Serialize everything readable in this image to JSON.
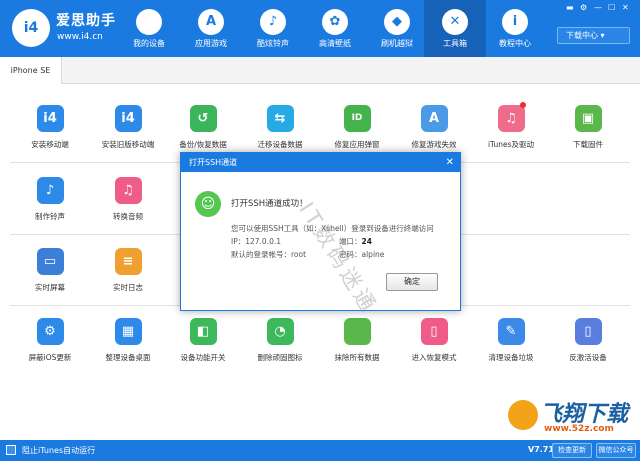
{
  "app": {
    "brand": "爱思助手",
    "url": "www.i4.cn",
    "logo_text": "i4"
  },
  "nav": [
    {
      "label": "我的设备",
      "icon": "apple-icon",
      "glyph": ""
    },
    {
      "label": "应用游戏",
      "icon": "app-store-icon",
      "glyph": "A"
    },
    {
      "label": "酷炫铃声",
      "icon": "bell-icon",
      "glyph": "♪"
    },
    {
      "label": "高清壁纸",
      "icon": "flower-icon",
      "glyph": "✿"
    },
    {
      "label": "刷机越狱",
      "icon": "dropbox-icon",
      "glyph": "◆"
    },
    {
      "label": "工具箱",
      "icon": "tools-icon",
      "glyph": "✕"
    },
    {
      "label": "教程中心",
      "icon": "info-icon",
      "glyph": "i"
    }
  ],
  "window_controls": [
    "▬",
    "⚙",
    "—",
    "☐",
    "✕"
  ],
  "download_center": "下载中心 ▾",
  "device_tab": "iPhone SE",
  "tools_row1": [
    {
      "label": "安装移动端",
      "icon": "i4-app-icon",
      "color": "#2d8ae8",
      "glyph": "i4"
    },
    {
      "label": "安装旧版移动端",
      "icon": "i4-legacy-app-icon",
      "color": "#2d8ae8",
      "glyph": "i4"
    },
    {
      "label": "备份/恢复数据",
      "icon": "backup-restore-icon",
      "color": "#3bb55a",
      "glyph": "↺"
    },
    {
      "label": "迁移设备数据",
      "icon": "migrate-data-icon",
      "color": "#27a9e6",
      "glyph": "⇆"
    },
    {
      "label": "修复应用弹窗",
      "icon": "repair-app-popup-icon",
      "color": "#44b34c",
      "glyph": "ID"
    },
    {
      "label": "修复游戏失效",
      "icon": "repair-game-icon",
      "color": "#4a9ae8",
      "glyph": "A"
    },
    {
      "label": "iTunes及驱动",
      "icon": "itunes-icon",
      "color": "#f06a8c",
      "glyph": "♫"
    },
    {
      "label": "下载固件",
      "icon": "firmware-cube-icon",
      "color": "#5ab84a",
      "glyph": "▣"
    }
  ],
  "tools_row2": [
    {
      "label": "制作铃声",
      "icon": "bell-maker-icon",
      "color": "#2d8ae8",
      "glyph": "♪"
    },
    {
      "label": "转换音频",
      "icon": "audio-convert-icon",
      "color": "#f05c8a",
      "glyph": "♫"
    }
  ],
  "tools_row3": [
    {
      "label": "实时屏幕",
      "icon": "realtime-screen-icon",
      "color": "#3c7fd8",
      "glyph": "▭"
    },
    {
      "label": "实时日志",
      "icon": "realtime-log-icon",
      "color": "#f0a030",
      "glyph": "≡"
    }
  ],
  "tools_row4": [
    {
      "label": "屏蔽iOS更新",
      "icon": "block-update-icon",
      "color": "#2d8ae8",
      "glyph": "⚙"
    },
    {
      "label": "整理设备桌面",
      "icon": "organize-desktop-icon",
      "color": "#2d8ae8",
      "glyph": "▦"
    },
    {
      "label": "设备功能开关",
      "icon": "feature-toggle-icon",
      "color": "#3db85a",
      "glyph": "◧"
    },
    {
      "label": "删除顽固图标",
      "icon": "delete-icon-icon",
      "color": "#3db85a",
      "glyph": "◔"
    },
    {
      "label": "抹除所有数据",
      "icon": "erase-data-icon",
      "color": "#5ab84a",
      "glyph": ""
    },
    {
      "label": "进入恢复模式",
      "icon": "recovery-mode-icon",
      "color": "#f05c8a",
      "glyph": "▯"
    },
    {
      "label": "清理设备垃圾",
      "icon": "clean-junk-icon",
      "color": "#3c8ae8",
      "glyph": "✎"
    },
    {
      "label": "反激活设备",
      "icon": "deactivate-icon",
      "color": "#5a7ee0",
      "glyph": "▯"
    }
  ],
  "dialog": {
    "title": "打开SSH通道",
    "close": "✕",
    "success": "打开SSH通道成功！",
    "instruction": "您可以使用SSH工具（如：Xshell）登录到设备进行终端访问",
    "ip_label": "IP：127.0.0.1",
    "port_label": "端口：",
    "port_value": "24",
    "account_label": "默认的登录帐号：root",
    "password_label": "密码：alpine",
    "ok": "确定"
  },
  "footer": {
    "itunes_autorun": "阻止iTunes自动运行",
    "version": "V7.71",
    "check_update": "检查更新",
    "wechat": "微信公众号"
  },
  "watermark": "IT数码迷通",
  "site_brand": {
    "name": "飞翔下载",
    "url": "www.52z.com"
  }
}
